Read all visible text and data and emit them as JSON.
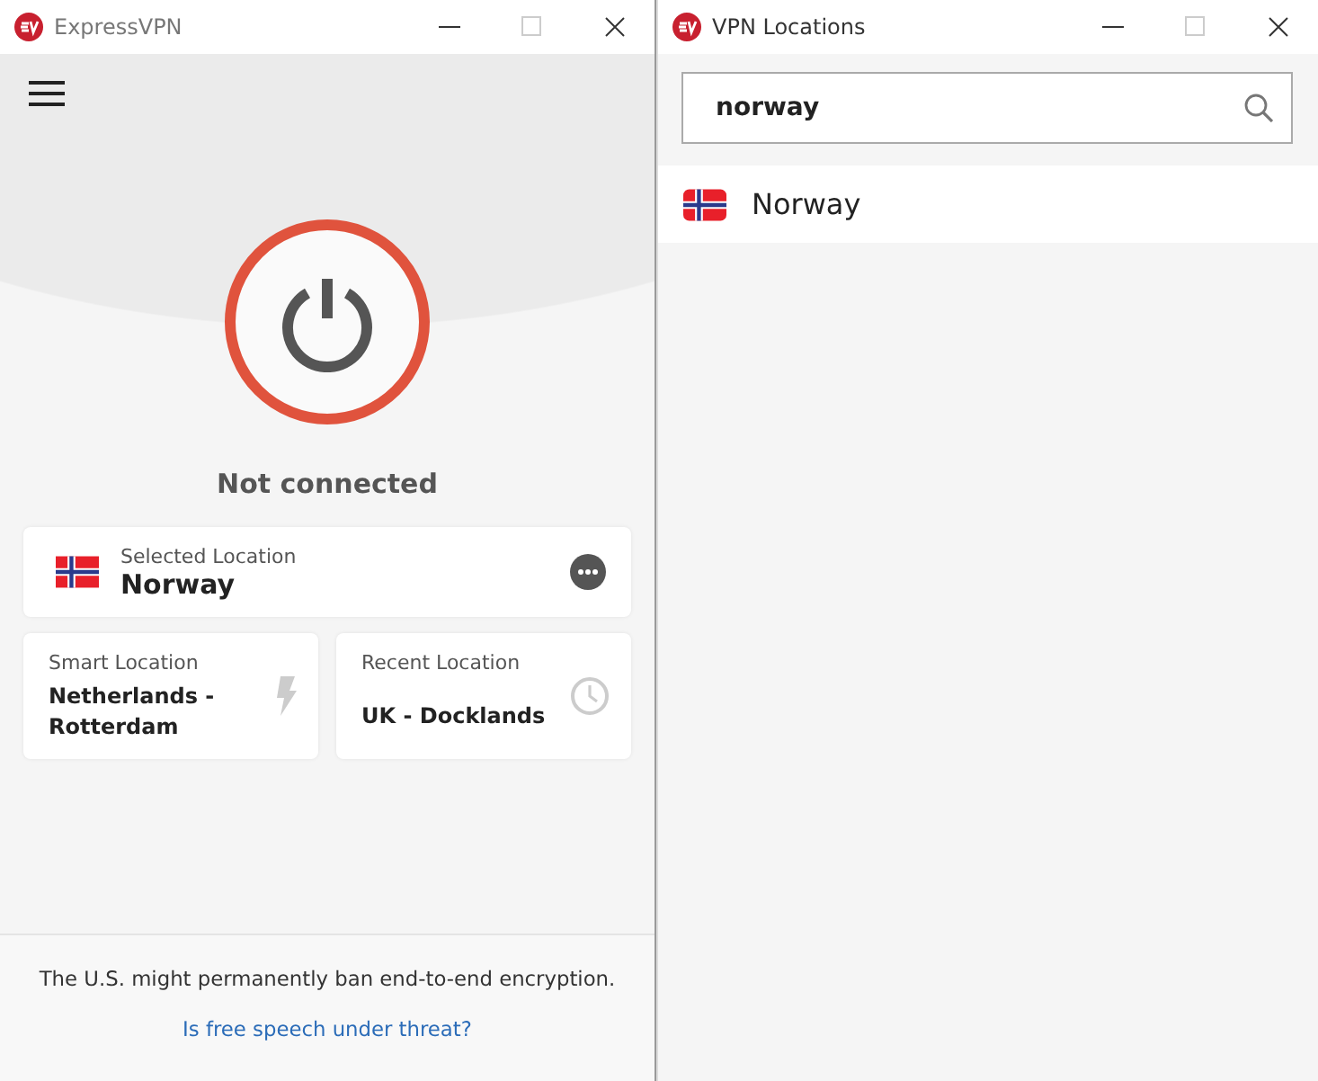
{
  "main_window": {
    "title": "ExpressVPN",
    "status": "Not connected",
    "connected": false,
    "selected_location": {
      "label": "Selected Location",
      "name": "Norway"
    },
    "shortcuts": [
      {
        "kind": "smart",
        "label": "Smart Location",
        "name": "Netherlands - Rotterdam"
      },
      {
        "kind": "recent",
        "label": "Recent Location",
        "name": "UK - Docklands"
      }
    ],
    "footer": {
      "message": "The U.S. might permanently ban end-to-end encryption.",
      "link": "Is free speech under threat?"
    }
  },
  "locations_window": {
    "title": "VPN Locations",
    "search": {
      "value": "norway"
    },
    "results": [
      {
        "name": "Norway"
      }
    ]
  }
}
